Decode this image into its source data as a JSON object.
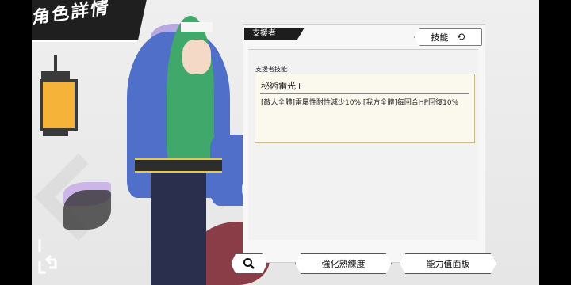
{
  "title": "角色詳情",
  "panel": {
    "support_tab": "支援者",
    "skill_button": "技能",
    "skill_section_label": "支援者技能",
    "skill_name": "秘術雷光+",
    "skill_desc": "[敵人全體]雷屬性耐性減少10% [我方全體]每回合HP回復10%"
  },
  "buttons": {
    "enhance": "強化熟練度",
    "stats": "能力值面板"
  },
  "icons": {
    "swap": "swap-icon",
    "search": "search-icon",
    "back": "back-icon",
    "lantern": "lantern-icon"
  },
  "colors": {
    "accent_dark": "#1d1d1d",
    "skill_border": "#c8b98d",
    "robe_blue": "#4f6fc9",
    "hair_green": "#3fa86a"
  }
}
